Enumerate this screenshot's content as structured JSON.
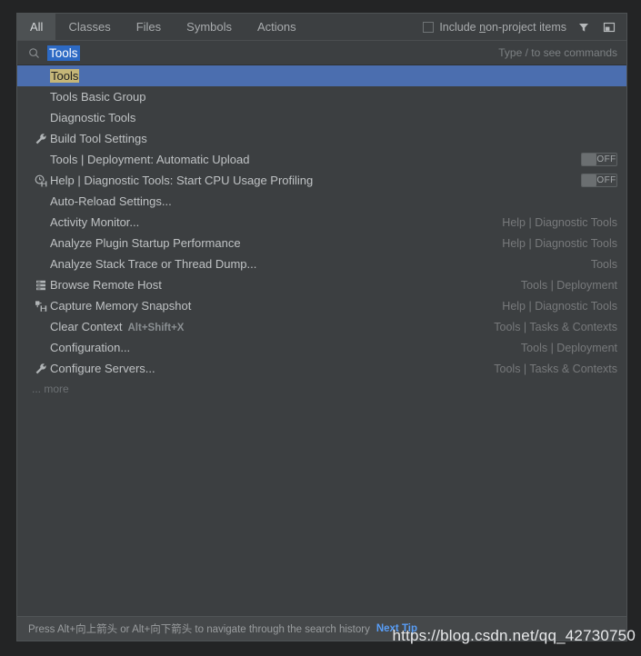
{
  "tabs": [
    {
      "label": "All",
      "selected": true
    },
    {
      "label": "Classes",
      "selected": false
    },
    {
      "label": "Files",
      "selected": false
    },
    {
      "label": "Symbols",
      "selected": false
    },
    {
      "label": "Actions",
      "selected": false
    }
  ],
  "toolbar": {
    "checkbox_label_pre": "Include ",
    "checkbox_label_key": "n",
    "checkbox_label_post": "on-project items",
    "checkbox_checked": false,
    "filter_icon": "filter-icon",
    "panel_icon": "preview-panel-icon"
  },
  "search": {
    "icon": "search-icon",
    "value": "Tools",
    "hint": "Type / to see commands"
  },
  "results": [
    {
      "icon": "",
      "label": "",
      "match": "Tools",
      "right": "",
      "selected": true
    },
    {
      "icon": "",
      "label": "Tools Basic Group",
      "right": ""
    },
    {
      "icon": "",
      "label": "Diagnostic Tools",
      "right": ""
    },
    {
      "icon": "wrench-icon",
      "label": "Build Tool Settings",
      "right": ""
    },
    {
      "icon": "",
      "label": "Tools | Deployment: Automatic Upload",
      "right": "",
      "toggle": "OFF"
    },
    {
      "icon": "cpu-profiling-icon",
      "label": "Help | Diagnostic Tools: Start CPU Usage Profiling",
      "right": "",
      "toggle": "OFF"
    },
    {
      "icon": "",
      "label": "Auto-Reload Settings...",
      "right": ""
    },
    {
      "icon": "",
      "label": "Activity Monitor...",
      "right": "Help | Diagnostic Tools"
    },
    {
      "icon": "",
      "label": "Analyze Plugin Startup Performance",
      "right": "Help | Diagnostic Tools"
    },
    {
      "icon": "",
      "label": "Analyze Stack Trace or Thread Dump...",
      "right": "Tools"
    },
    {
      "icon": "remote-host-icon",
      "label": "Browse Remote Host",
      "right": "Tools | Deployment"
    },
    {
      "icon": "memory-snapshot-icon",
      "label": "Capture Memory Snapshot",
      "right": "Help | Diagnostic Tools"
    },
    {
      "icon": "",
      "label": "Clear Context",
      "shortcut": "Alt+Shift+X",
      "right": "Tools | Tasks & Contexts"
    },
    {
      "icon": "",
      "label": "Configuration...",
      "right": "Tools | Deployment"
    },
    {
      "icon": "wrench-icon",
      "label": "Configure Servers...",
      "right": "Tools | Tasks & Contexts"
    }
  ],
  "more_label": "... more",
  "footer": {
    "hint": "Press Alt+向上箭头 or Alt+向下箭头 to navigate through the search history",
    "next_tip": "Next Tip"
  },
  "watermark": "https://blog.csdn.net/qq_42730750",
  "colors": {
    "popup_bg": "#3c3f41",
    "selection": "#4b6eaf",
    "match_highlight": "#c5b678",
    "search_selection": "#2d6ac4",
    "link": "#589df6",
    "outer_bg": "#232425"
  }
}
